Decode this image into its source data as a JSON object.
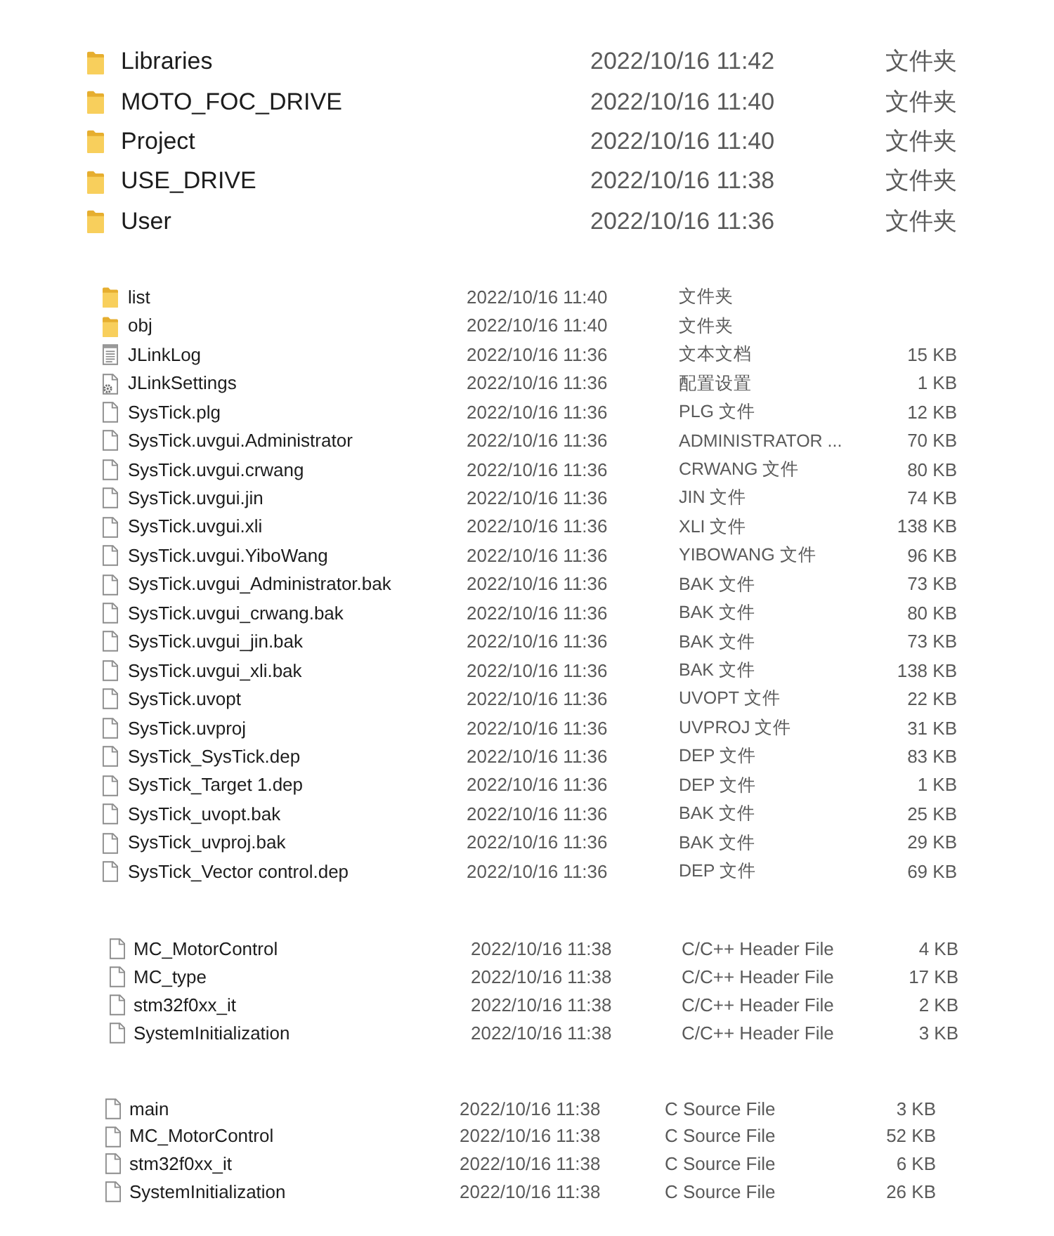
{
  "top_folders": [
    {
      "kind": "folder",
      "name": "Libraries",
      "modified": "2022/10/16 11:42",
      "type": "文件夹"
    },
    {
      "kind": "folder",
      "name": "MOTO_FOC_DRIVE",
      "modified": "2022/10/16 11:40",
      "type": "文件夹"
    },
    {
      "kind": "folder",
      "name": "Project",
      "modified": "2022/10/16 11:40",
      "type": "文件夹"
    },
    {
      "kind": "folder",
      "name": "USE_DRIVE",
      "modified": "2022/10/16 11:38",
      "type": "文件夹"
    },
    {
      "kind": "folder",
      "name": "User",
      "modified": "2022/10/16 11:36",
      "type": "文件夹"
    }
  ],
  "project_files": [
    {
      "kind": "folder",
      "name": "list",
      "modified": "2022/10/16 11:40",
      "type": "文件夹"
    },
    {
      "kind": "folder",
      "name": "obj",
      "modified": "2022/10/16 11:40",
      "type": "文件夹"
    },
    {
      "kind": "text",
      "name": "JLinkLog",
      "modified": "2022/10/16 11:36",
      "type": "文本文档",
      "size": "15 KB"
    },
    {
      "kind": "settings",
      "name": "JLinkSettings",
      "modified": "2022/10/16 11:36",
      "type": "配置设置",
      "size": "1 KB"
    },
    {
      "kind": "file",
      "name": "SysTick.plg",
      "modified": "2022/10/16 11:36",
      "type": "PLG 文件",
      "size": "12 KB"
    },
    {
      "kind": "file",
      "name": "SysTick.uvgui.Administrator",
      "modified": "2022/10/16 11:36",
      "type": "ADMINISTRATOR ...",
      "size": "70 KB"
    },
    {
      "kind": "file",
      "name": "SysTick.uvgui.crwang",
      "modified": "2022/10/16 11:36",
      "type": "CRWANG 文件",
      "size": "80 KB"
    },
    {
      "kind": "file",
      "name": "SysTick.uvgui.jin",
      "modified": "2022/10/16 11:36",
      "type": "JIN 文件",
      "size": "74 KB"
    },
    {
      "kind": "file",
      "name": "SysTick.uvgui.xli",
      "modified": "2022/10/16 11:36",
      "type": "XLI 文件",
      "size": "138 KB"
    },
    {
      "kind": "file",
      "name": "SysTick.uvgui.YiboWang",
      "modified": "2022/10/16 11:36",
      "type": "YIBOWANG 文件",
      "size": "96 KB"
    },
    {
      "kind": "file",
      "name": "SysTick.uvgui_Administrator.bak",
      "modified": "2022/10/16 11:36",
      "type": "BAK 文件",
      "size": "73 KB"
    },
    {
      "kind": "file",
      "name": "SysTick.uvgui_crwang.bak",
      "modified": "2022/10/16 11:36",
      "type": "BAK 文件",
      "size": "80 KB"
    },
    {
      "kind": "file",
      "name": "SysTick.uvgui_jin.bak",
      "modified": "2022/10/16 11:36",
      "type": "BAK 文件",
      "size": "73 KB"
    },
    {
      "kind": "file",
      "name": "SysTick.uvgui_xli.bak",
      "modified": "2022/10/16 11:36",
      "type": "BAK 文件",
      "size": "138 KB"
    },
    {
      "kind": "file",
      "name": "SysTick.uvopt",
      "modified": "2022/10/16 11:36",
      "type": "UVOPT 文件",
      "size": "22 KB"
    },
    {
      "kind": "file",
      "name": "SysTick.uvproj",
      "modified": "2022/10/16 11:36",
      "type": "UVPROJ 文件",
      "size": "31 KB"
    },
    {
      "kind": "file",
      "name": "SysTick_SysTick.dep",
      "modified": "2022/10/16 11:36",
      "type": "DEP 文件",
      "size": "83 KB"
    },
    {
      "kind": "file",
      "name": "SysTick_Target 1.dep",
      "modified": "2022/10/16 11:36",
      "type": "DEP 文件",
      "size": "1 KB"
    },
    {
      "kind": "file",
      "name": "SysTick_uvopt.bak",
      "modified": "2022/10/16 11:36",
      "type": "BAK 文件",
      "size": "25 KB"
    },
    {
      "kind": "file",
      "name": "SysTick_uvproj.bak",
      "modified": "2022/10/16 11:36",
      "type": "BAK 文件",
      "size": "29 KB"
    },
    {
      "kind": "file",
      "name": "SysTick_Vector control.dep",
      "modified": "2022/10/16 11:36",
      "type": "DEP 文件",
      "size": "69 KB"
    }
  ],
  "header_files": [
    {
      "kind": "file",
      "name": "MC_MotorControl",
      "modified": "2022/10/16 11:38",
      "type": "C/C++ Header File",
      "size": "4 KB"
    },
    {
      "kind": "file",
      "name": "MC_type",
      "modified": "2022/10/16 11:38",
      "type": "C/C++ Header File",
      "size": "17 KB"
    },
    {
      "kind": "file",
      "name": "stm32f0xx_it",
      "modified": "2022/10/16 11:38",
      "type": "C/C++ Header File",
      "size": "2 KB"
    },
    {
      "kind": "file",
      "name": "SystemInitialization",
      "modified": "2022/10/16 11:38",
      "type": "C/C++ Header File",
      "size": "3 KB"
    }
  ],
  "source_files": [
    {
      "kind": "file",
      "name": "main",
      "modified": "2022/10/16 11:38",
      "type": "C Source File",
      "size": "3 KB"
    },
    {
      "kind": "file",
      "name": "MC_MotorControl",
      "modified": "2022/10/16 11:38",
      "type": "C Source File",
      "size": "52 KB"
    },
    {
      "kind": "file",
      "name": "stm32f0xx_it",
      "modified": "2022/10/16 11:38",
      "type": "C Source File",
      "size": "6 KB"
    },
    {
      "kind": "file",
      "name": "SystemInitialization",
      "modified": "2022/10/16 11:38",
      "type": "C Source File",
      "size": "26 KB"
    }
  ]
}
